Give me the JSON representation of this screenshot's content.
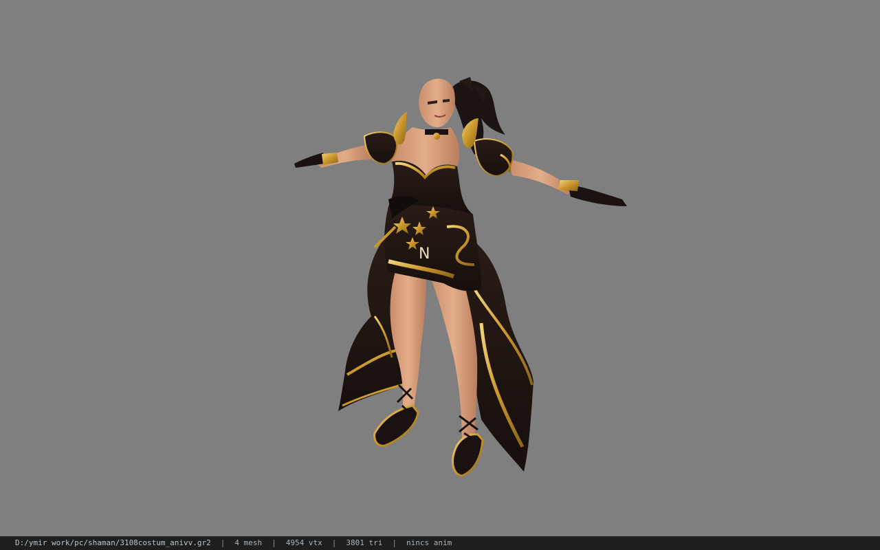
{
  "viewer": {
    "background_color": "#7f7f7f",
    "status_bar_color": "#1e1e1e"
  },
  "model_preview": {
    "icon": "character-model-preview",
    "emblem_text": "N"
  },
  "status": {
    "file_path": "D:/ymir work/pc/shaman/3108costum_anivv.gr2",
    "separator": "|",
    "mesh_count": "4 mesh",
    "vertex_count": "4954 vtx",
    "triangle_count": "3801 tri",
    "anim_status": "nincs anim"
  }
}
